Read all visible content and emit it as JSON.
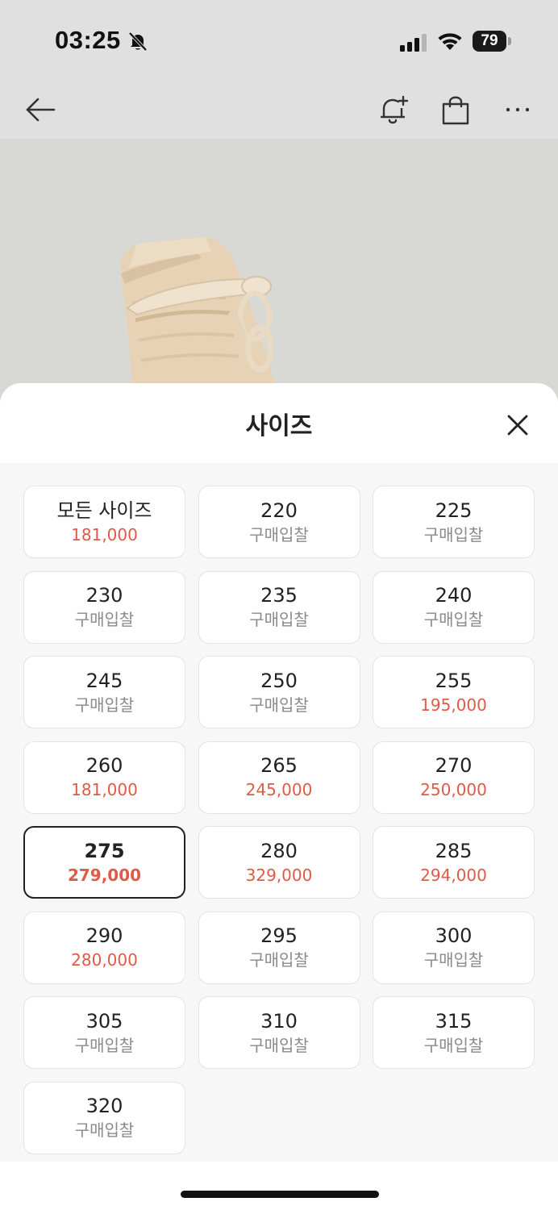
{
  "status_bar": {
    "time": "03:25",
    "battery": "79"
  },
  "icons": {
    "status": [
      "bell-slash-icon",
      "signal-icon",
      "wifi-icon",
      "battery-icon"
    ],
    "nav": [
      "arrow-left-icon",
      "bell-plus-icon",
      "shopping-bag-icon",
      "more-dots-icon"
    ],
    "sheet": [
      "close-icon"
    ]
  },
  "sheet": {
    "title": "사이즈",
    "sizes": [
      {
        "label": "모든 사이즈",
        "price": "181,000",
        "type": "red",
        "selected": false
      },
      {
        "label": "220",
        "price": "구매입찰",
        "type": "bid",
        "selected": false
      },
      {
        "label": "225",
        "price": "구매입찰",
        "type": "bid",
        "selected": false
      },
      {
        "label": "230",
        "price": "구매입찰",
        "type": "bid",
        "selected": false
      },
      {
        "label": "235",
        "price": "구매입찰",
        "type": "bid",
        "selected": false
      },
      {
        "label": "240",
        "price": "구매입찰",
        "type": "bid",
        "selected": false
      },
      {
        "label": "245",
        "price": "구매입찰",
        "type": "bid",
        "selected": false
      },
      {
        "label": "250",
        "price": "구매입찰",
        "type": "bid",
        "selected": false
      },
      {
        "label": "255",
        "price": "195,000",
        "type": "red",
        "selected": false
      },
      {
        "label": "260",
        "price": "181,000",
        "type": "red",
        "selected": false
      },
      {
        "label": "265",
        "price": "245,000",
        "type": "red",
        "selected": false
      },
      {
        "label": "270",
        "price": "250,000",
        "type": "red",
        "selected": false
      },
      {
        "label": "275",
        "price": "279,000",
        "type": "red",
        "selected": true
      },
      {
        "label": "280",
        "price": "329,000",
        "type": "red",
        "selected": false
      },
      {
        "label": "285",
        "price": "294,000",
        "type": "red",
        "selected": false
      },
      {
        "label": "290",
        "price": "280,000",
        "type": "red",
        "selected": false
      },
      {
        "label": "295",
        "price": "구매입찰",
        "type": "bid",
        "selected": false
      },
      {
        "label": "300",
        "price": "구매입찰",
        "type": "bid",
        "selected": false
      },
      {
        "label": "305",
        "price": "구매입찰",
        "type": "bid",
        "selected": false
      },
      {
        "label": "310",
        "price": "구매입찰",
        "type": "bid",
        "selected": false
      },
      {
        "label": "315",
        "price": "구매입찰",
        "type": "bid",
        "selected": false
      },
      {
        "label": "320",
        "price": "구매입찰",
        "type": "bid",
        "selected": false
      }
    ]
  },
  "colors": {
    "price_red": "#e05a47",
    "bid_gray": "#8a8a8a",
    "selected_border": "#222222"
  }
}
